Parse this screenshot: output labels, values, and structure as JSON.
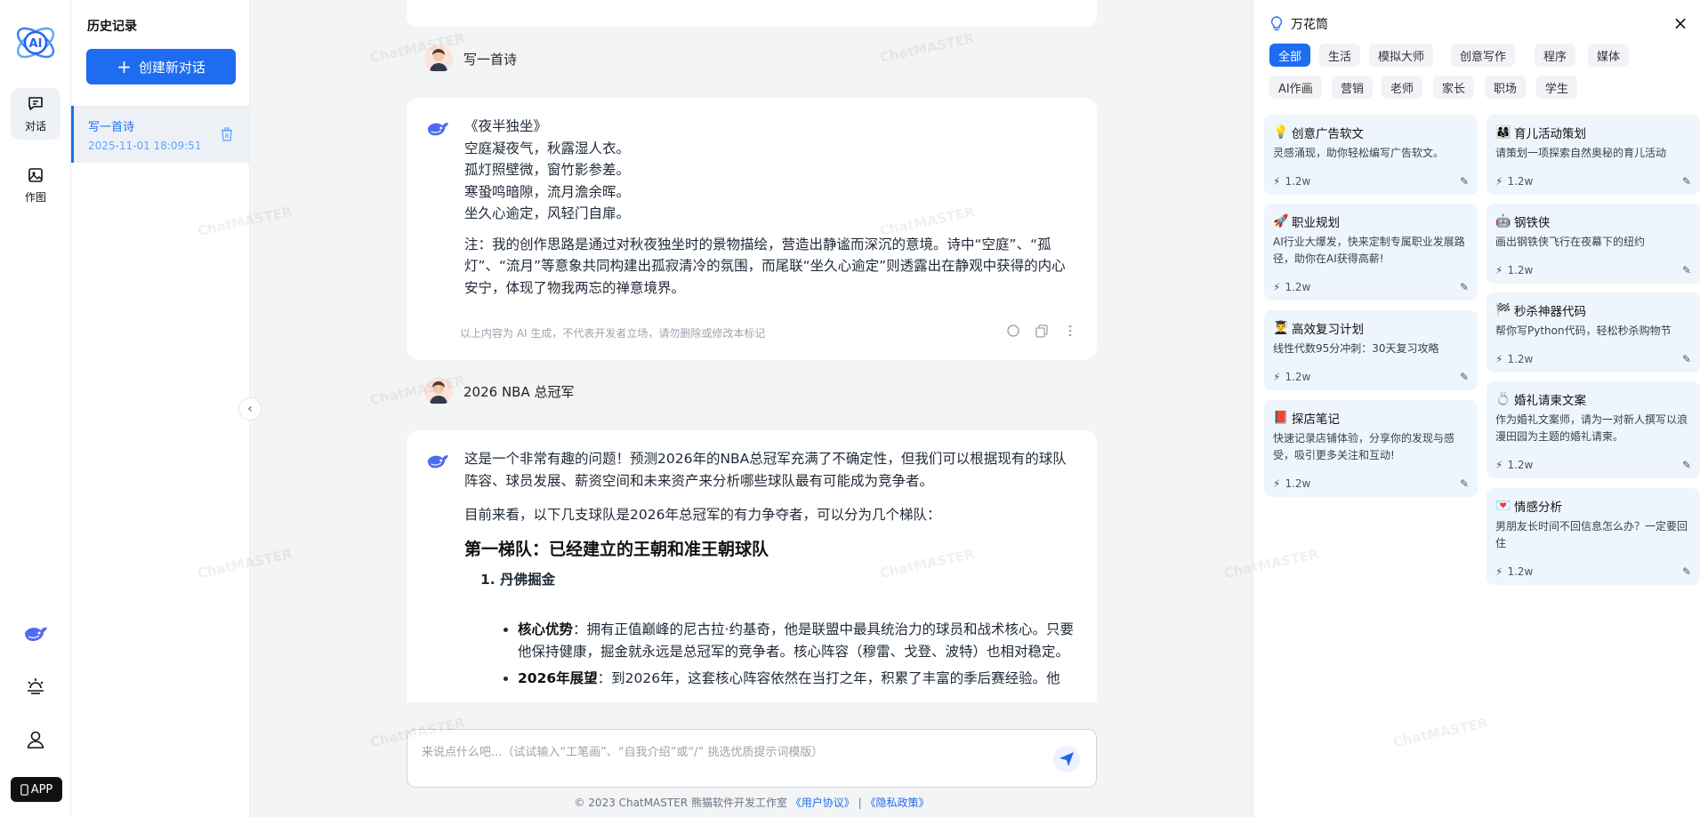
{
  "rail": {
    "items": [
      {
        "label": "对话",
        "icon": "chat-icon"
      },
      {
        "label": "作图",
        "icon": "image-icon"
      }
    ],
    "app_label": "APP"
  },
  "history": {
    "title": "历史记录",
    "new_chat_label": "创建新对话",
    "items": [
      {
        "title": "写一首诗",
        "time": "2025-11-01 18:09:51"
      }
    ]
  },
  "chat": {
    "messages": [
      {
        "role": "user",
        "text": "写一首诗"
      },
      {
        "role": "bot",
        "poem": [
          "《夜半独坐》",
          "空庭凝夜气，秋露湿人衣。",
          "孤灯照壁微，窗竹影参差。",
          "寒蛩鸣暗隙，流月澹余晖。",
          "坐久心逾定，风轻门自扉。"
        ],
        "note": "注：我的创作思路是通过对秋夜独坐时的景物描绘，营造出静谧而深沉的意境。诗中“空庭”、“孤灯”、“流月”等意象共同构建出孤寂清冷的氛围，而尾联“坐久心逾定”则透露出在静观中获得的内心安宁，体现了物我两忘的禅意境界。",
        "disclaimer": "以上内容为 AI 生成，不代表开发者立场，请勿删除或修改本标记"
      },
      {
        "role": "user",
        "text": "2026 NBA 总冠军"
      },
      {
        "role": "bot",
        "p1": "这是一个非常有趣的问题！预测2026年的NBA总冠军充满了不确定性，但我们可以根据现有的球队阵容、球员发展、薪资空间和未来资产来分析哪些球队最有可能成为竞争者。",
        "p2": "目前来看，以下几支球队是2026年总冠军的有力争夺者，可以分为几个梯队：",
        "h3": "第一梯队：已经建立的王朝和准王朝球队",
        "ol1": "1. 丹佛掘金",
        "li1_label": "核心优势",
        "li1_text": "：拥有正值巅峰的尼古拉·约基奇，他是联盟中最具统治力的球员和战术核心。只要他保持健康，掘金就永远是总冠军的竞争者。核心阵容（穆雷、戈登、波特）也相对稳定。",
        "li2_label": "2026年展望",
        "li2_text": "：到2026年，这套核心阵容依然在当打之年，积累了丰富的季后赛经验。他"
      }
    ]
  },
  "input": {
    "placeholder": "来说点什么吧...（试试输入“工笔画”、“自我介绍”或“/” 挑选优质提示词模版）"
  },
  "footer": {
    "copyright": "© 2023 ChatMASTER 熊猫软件开发工作室",
    "terms": "《用户协议》",
    "sep": "|",
    "privacy": "《隐私政策》"
  },
  "kaleidoscope": {
    "title": "万花筒",
    "categories": [
      "全部",
      "生活",
      "模拟大师",
      "创意写作",
      "程序",
      "媒体",
      "AI作画",
      "营销",
      "老师",
      "家长",
      "职场",
      "学生"
    ],
    "cards_left": [
      {
        "emoji": "💡",
        "title": "创意广告软文",
        "desc": "灵感涌现，助你轻松编写广告软文。",
        "count": "1.2w"
      },
      {
        "emoji": "🚀",
        "title": "职业规划",
        "desc": "AI行业大爆发，快来定制专属职业发展路径，助你在AI获得高薪!",
        "count": "1.2w"
      },
      {
        "emoji": "👨‍🎓",
        "title": "高效复习计划",
        "desc": "线性代数95分冲刺：30天复习攻略",
        "count": "1.2w"
      },
      {
        "emoji": "📕",
        "title": "探店笔记",
        "desc": "快速记录店铺体验，分享你的发现与感受，吸引更多关注和互动!",
        "count": "1.2w"
      }
    ],
    "cards_right": [
      {
        "emoji": "👨‍👩‍👧",
        "title": "育儿活动策划",
        "desc": "请策划一项探索自然奥秘的育儿活动",
        "count": "1.2w"
      },
      {
        "emoji": "🤖",
        "title": "钢铁侠",
        "desc": "画出钢铁侠飞行在夜幕下的纽约",
        "count": "1.2w"
      },
      {
        "emoji": "🏁",
        "title": "秒杀神器代码",
        "desc": "帮你写Python代码，轻松秒杀购物节",
        "count": "1.2w"
      },
      {
        "emoji": "💍",
        "title": "婚礼请柬文案",
        "desc": "作为婚礼文案师，请为一对新人撰写以浪漫田园为主题的婚礼请柬。",
        "count": "1.2w"
      },
      {
        "emoji": "💌",
        "title": "情感分析",
        "desc": "男朋友长时间不回信息怎么办？一定要回住",
        "count": "1.2w"
      }
    ]
  },
  "watermark": "ChatMASTER"
}
